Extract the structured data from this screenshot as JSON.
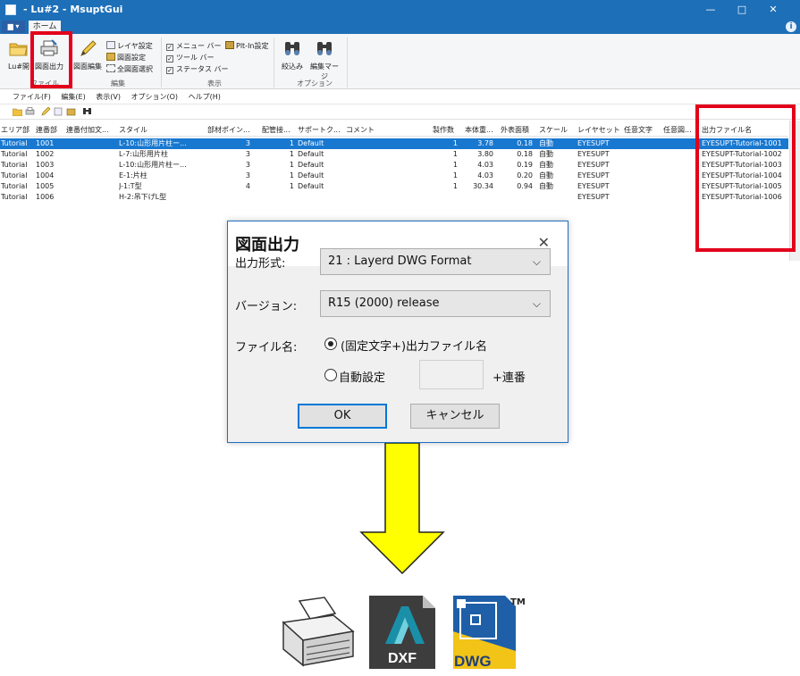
{
  "window": {
    "title": "- Lu#2 - MsuptGui",
    "minimize": "—",
    "maximize": "□",
    "close": "✕"
  },
  "ribbon": {
    "app_tab": "▆ ▾",
    "home_tab": "ホーム",
    "help": "i",
    "lu_open": "Lu#開",
    "drawing_output": "図面出力",
    "drawing_edit": "図面編集",
    "layer_settings": "レイヤ設定",
    "drawing_settings": "図面設定",
    "select_all_drawings": "全図面選択",
    "menu_bar": "メニュー バー",
    "tool_bar": "ツール バー",
    "status_bar": "ステータス バー",
    "plugin_settings": "Plt-In設定",
    "filter": "絞込み",
    "edit_merge": "編集マージ",
    "group_file": "ファイル",
    "group_edit": "編集",
    "group_view": "表示",
    "group_option": "オプション"
  },
  "menu": [
    "ファイル(F)",
    "編集(E)",
    "表示(V)",
    "オプション(O)",
    "ヘルプ(H)"
  ],
  "table": {
    "columns": [
      "エリア部",
      "連番部",
      "連番付加文...",
      "スタイル",
      "部材ポイン...",
      "配管接...",
      "サポートク...",
      "コメント",
      "製作数",
      "本体重...",
      "外表面積",
      "スケール",
      "レイヤセット",
      "任意文字",
      "任意図...",
      "出力ファイル名"
    ],
    "rows": [
      [
        "Tutorial",
        "1001",
        "",
        "L-10:山形用片柱ー...",
        "3",
        "1",
        "Default",
        "",
        "1",
        "3.78",
        "0.18",
        "自動",
        "EYESUPT",
        "",
        "",
        "EYESUPT-Tutorial-1001"
      ],
      [
        "Tutorial",
        "1002",
        "",
        "L-7:山形用片柱",
        "3",
        "1",
        "Default",
        "",
        "1",
        "3.80",
        "0.18",
        "自動",
        "EYESUPT",
        "",
        "",
        "EYESUPT-Tutorial-1002"
      ],
      [
        "Tutorial",
        "1003",
        "",
        "L-10:山形用片柱ー...",
        "3",
        "1",
        "Default",
        "",
        "1",
        "4.03",
        "0.19",
        "自動",
        "EYESUPT",
        "",
        "",
        "EYESUPT-Tutorial-1003"
      ],
      [
        "Tutorial",
        "1004",
        "",
        "E-1:片柱",
        "3",
        "1",
        "Default",
        "",
        "1",
        "4.03",
        "0.20",
        "自動",
        "EYESUPT",
        "",
        "",
        "EYESUPT-Tutorial-1004"
      ],
      [
        "Tutorial",
        "1005",
        "",
        "J-1:T型",
        "4",
        "1",
        "Default",
        "",
        "1",
        "30.34",
        "0.94",
        "自動",
        "EYESUPT",
        "",
        "",
        "EYESUPT-Tutorial-1005"
      ],
      [
        "Tutorial",
        "1006",
        "",
        "H-2:吊下げL型",
        "",
        "",
        "",
        "",
        "",
        "",
        "",
        "",
        "EYESUPT",
        "",
        "",
        "EYESUPT-Tutorial-1006"
      ]
    ]
  },
  "dialog": {
    "title": "図面出力",
    "close": "✕",
    "format_label": "出力形式:",
    "format_value": "21 : Layerd DWG Format",
    "version_label": "バージョン:",
    "version_value": "R15 (2000) release",
    "filename_label": "ファイル名:",
    "option_fixed": "(固定文字+)出力ファイル名",
    "option_auto": "自動設定",
    "serial_suffix": "+連番",
    "ok": "OK",
    "cancel": "キャンセル",
    "dropdown_arrow": "⌵"
  },
  "output_icons": {
    "dxf_label": "DXF",
    "dwg_label": "DWG",
    "tm": "TM"
  },
  "colors": {
    "highlight": "#e3001b",
    "arrow": "#ffff00",
    "accent": "#1d6fb8",
    "selected_row": "#1878d0"
  }
}
